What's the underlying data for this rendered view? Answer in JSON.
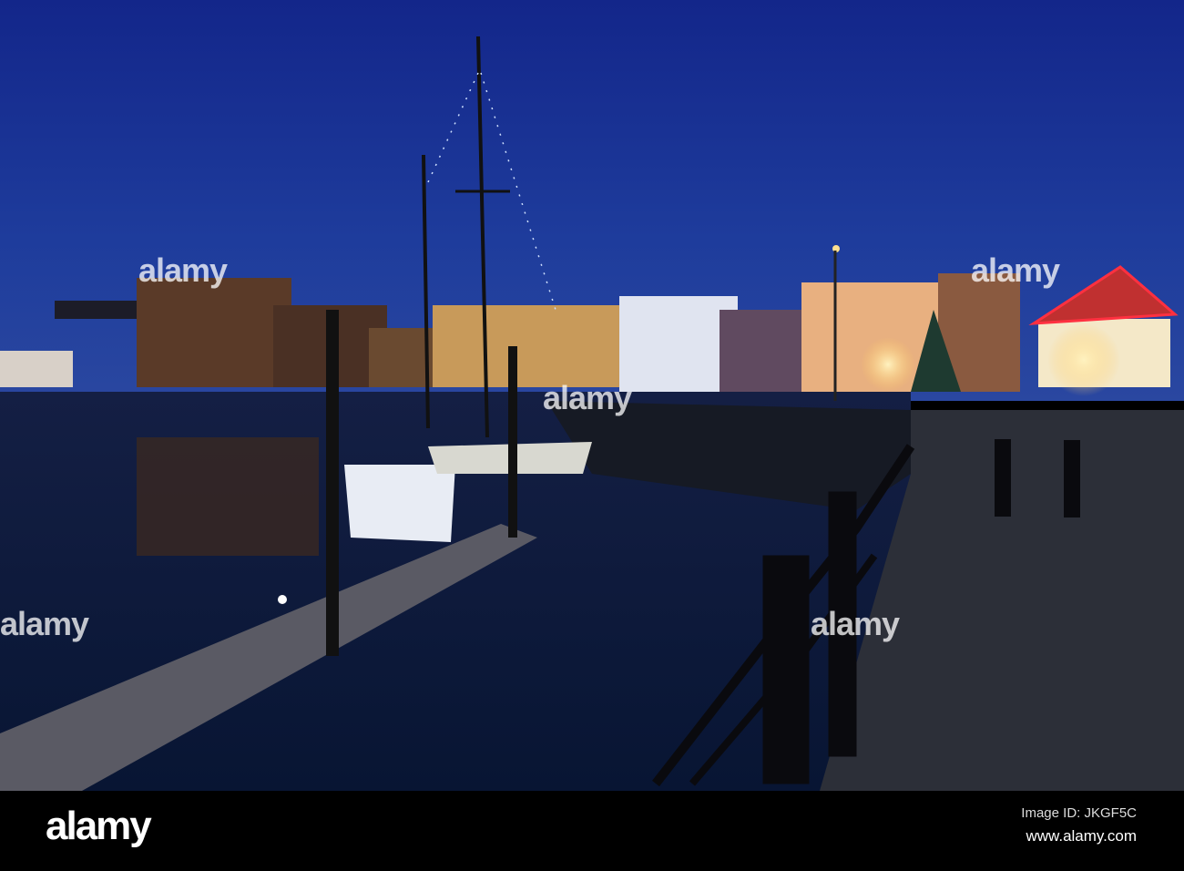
{
  "photo": {
    "subject": "harbour-at-dusk",
    "colors": {
      "sky": "#1a3a9a",
      "water": "#0b1a3c",
      "lights": "#ffcc66",
      "quay": "#2a2e38",
      "neon": "#ff3040"
    }
  },
  "watermark": {
    "text": "alamy"
  },
  "footer": {
    "logo": "alamy",
    "image_id": "Image ID: JKGF5C",
    "url": "www.alamy.com"
  }
}
